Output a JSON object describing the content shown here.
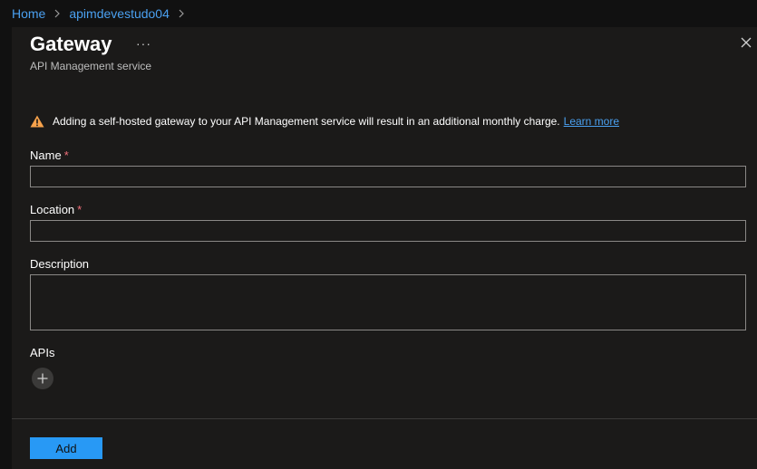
{
  "breadcrumb": {
    "items": [
      "Home",
      "apimdevestudo04"
    ]
  },
  "panel": {
    "title": "Gateway",
    "more_label": "···",
    "subtitle": "API Management service"
  },
  "warning": {
    "text": "Adding a self-hosted gateway to your API Management service will result in an additional monthly charge.",
    "link": "Learn more",
    "icon": "warning-icon",
    "color": "#f7a24b"
  },
  "form": {
    "name_label": "Name",
    "location_label": "Location",
    "description_label": "Description",
    "apis_label": "APIs",
    "required_marker": "*",
    "name_value": "",
    "location_value": "",
    "description_value": ""
  },
  "footer": {
    "add_label": "Add",
    "accent": "#2899f5"
  }
}
